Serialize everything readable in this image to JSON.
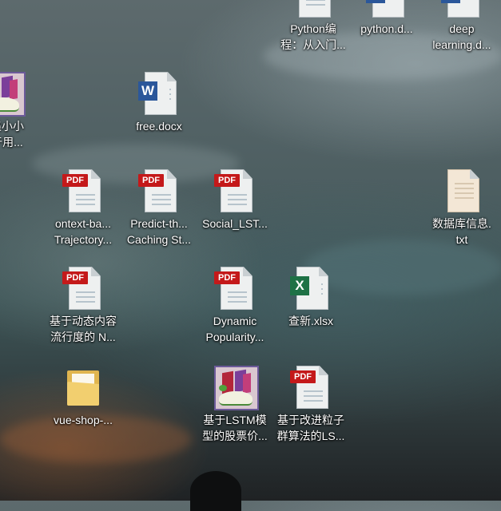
{
  "desktop": {
    "icons": [
      {
        "type": "doc-plain",
        "label": "Python编\n程：从入门..."
      },
      {
        "type": "word",
        "label": "python.d..."
      },
      {
        "type": "word",
        "label": "deep\nlearning.d..."
      },
      {
        "type": "book",
        "label": "窓集小小\n基于用..."
      },
      {
        "type": "word",
        "label": "free.docx"
      },
      {
        "type": "pdf",
        "label": "ontext-ba...\nTrajectory..."
      },
      {
        "type": "pdf",
        "label": "Predict-th...\nCaching St..."
      },
      {
        "type": "pdf",
        "label": "Social_LST..."
      },
      {
        "type": "txt",
        "label": "数据库信息.\ntxt"
      },
      {
        "type": "pdf",
        "label": "基于动态内容\n流行度的 N..."
      },
      {
        "type": "pdf",
        "label": "Dynamic\nPopularity..."
      },
      {
        "type": "excel",
        "label": "查新.xlsx"
      },
      {
        "type": "folder",
        "label": "vue-shop-..."
      },
      {
        "type": "book",
        "label": "基于LSTM模\n型的股票价..."
      },
      {
        "type": "pdf",
        "label": "基于改进粒子\n群算法的LS..."
      }
    ],
    "badges": {
      "pdf": "PDF",
      "word": "W",
      "excel": "X"
    }
  }
}
